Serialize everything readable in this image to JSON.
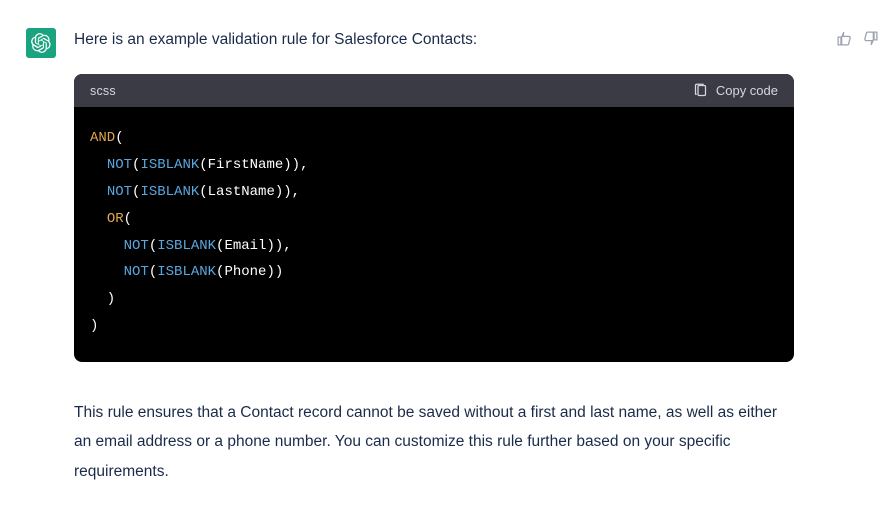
{
  "message": {
    "intro": "Here is an example validation rule for Salesforce Contacts:",
    "explanation": "This rule ensures that a Contact record cannot be saved without a first and last name, as well as either an email address or a phone number. You can customize this rule further based on your specific requirements."
  },
  "codeblock": {
    "language": "scss",
    "copy_label": "Copy code",
    "tokens": [
      {
        "t": "AND",
        "c": "hl-kw"
      },
      {
        "t": "(\n  "
      },
      {
        "t": "NOT",
        "c": "hl-fn"
      },
      {
        "t": "("
      },
      {
        "t": "ISBLANK",
        "c": "hl-fn"
      },
      {
        "t": "(FirstName)),\n  "
      },
      {
        "t": "NOT",
        "c": "hl-fn"
      },
      {
        "t": "("
      },
      {
        "t": "ISBLANK",
        "c": "hl-fn"
      },
      {
        "t": "(LastName)),\n  "
      },
      {
        "t": "OR",
        "c": "hl-kw"
      },
      {
        "t": "(\n    "
      },
      {
        "t": "NOT",
        "c": "hl-fn"
      },
      {
        "t": "("
      },
      {
        "t": "ISBLANK",
        "c": "hl-fn"
      },
      {
        "t": "(Email)),\n    "
      },
      {
        "t": "NOT",
        "c": "hl-fn"
      },
      {
        "t": "("
      },
      {
        "t": "ISBLANK",
        "c": "hl-fn"
      },
      {
        "t": "(Phone))\n  )\n)"
      }
    ]
  }
}
